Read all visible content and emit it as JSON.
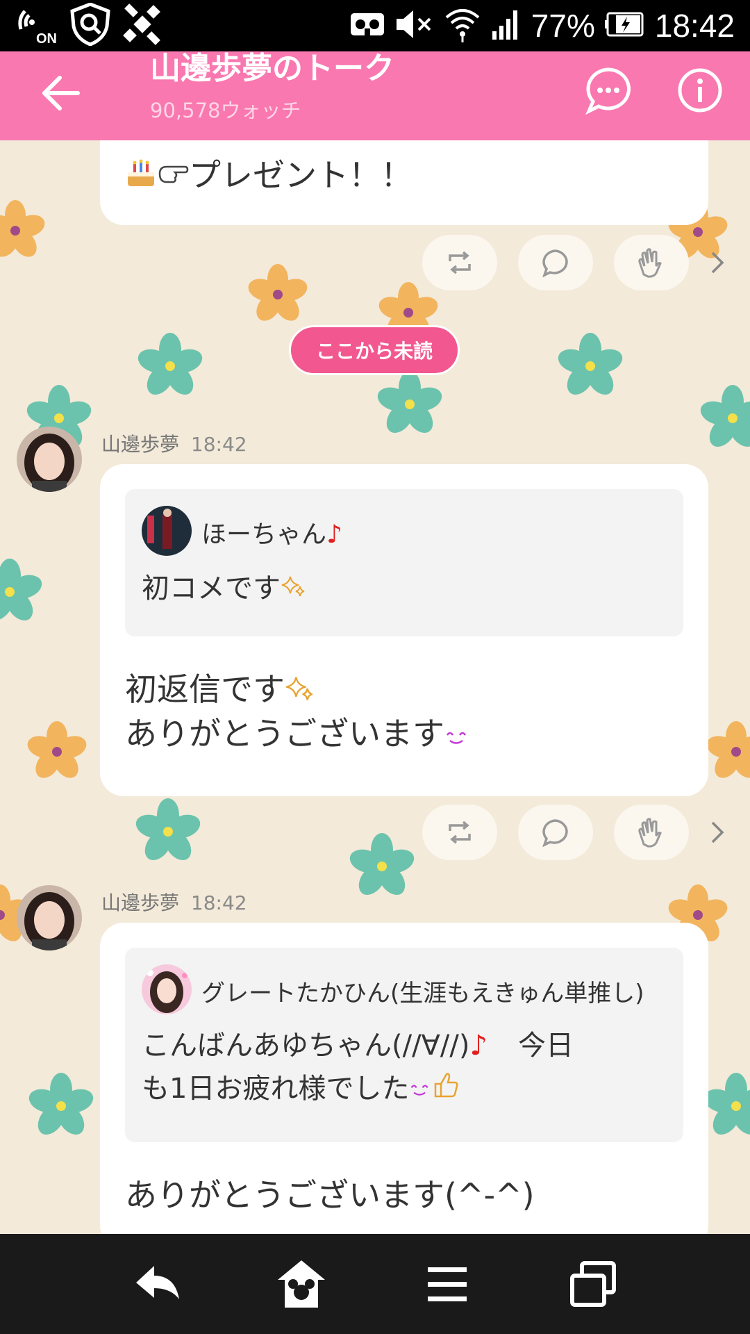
{
  "status_bar": {
    "battery": "77%",
    "time": "18:42",
    "nfc_label": "ON",
    "icons": [
      "nfc-icon",
      "search-shield-icon",
      "satellite-icon",
      "vr-icon",
      "mute-icon",
      "wifi-icon",
      "signal-icon",
      "battery-charging-icon"
    ]
  },
  "header": {
    "title": "山邊歩夢のトーク",
    "subtitle": "90,578ウォッチ",
    "icons": [
      "back-arrow-icon",
      "comment-bubble-icon",
      "info-icon"
    ]
  },
  "messages": {
    "prev_partial": {
      "text": "プレゼント！！",
      "emojis": [
        "cake-icon",
        "pointing-hand-icon"
      ]
    },
    "unread_label": "ここから未読",
    "msg1": {
      "sender": "山邊歩夢",
      "time": "18:42",
      "quote_name": "ほーちゃん",
      "quote_text": "初コメです",
      "reply_line1": "初返信です",
      "reply_line2": "ありがとうございます"
    },
    "msg2": {
      "sender": "山邊歩夢",
      "time": "18:42",
      "quote_name": "グレートたかひん(生涯もえきゅん単推し)",
      "quote_line1": "こんばんあゆちゃん(//∀//)",
      "quote_line1b": "今日",
      "quote_line2": "も1日お疲れ様でした",
      "reply_line1": "ありがとうございます(^-^)"
    }
  },
  "action_icons": [
    "retweet-icon",
    "comment-icon",
    "clap-icon",
    "chevron-right-icon"
  ],
  "nav_bar": {
    "icons": [
      "back-icon",
      "home-icon",
      "menu-icon",
      "recent-apps-icon"
    ]
  },
  "colors": {
    "header": "#f978b0",
    "unread_pill": "#f2588f",
    "background": "#f3ead9"
  }
}
